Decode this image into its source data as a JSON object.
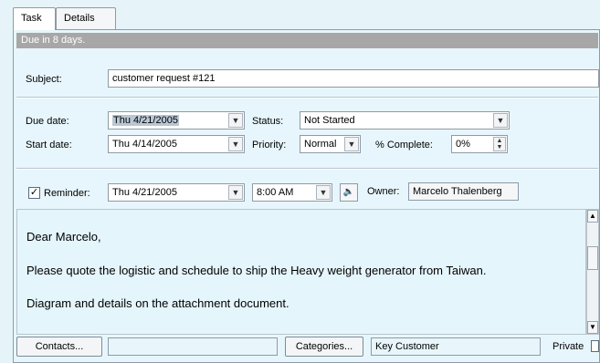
{
  "tabs": [
    {
      "label": "Task"
    },
    {
      "label": "Details"
    }
  ],
  "due_bar": {
    "text": "Due in 8 days."
  },
  "subject": {
    "label": "Subject:",
    "value": "customer request #121"
  },
  "due_date": {
    "label": "Due date:",
    "value": "Thu 4/21/2005"
  },
  "start_date": {
    "label": "Start date:",
    "value": "Thu 4/14/2005"
  },
  "status": {
    "label": "Status:",
    "value": "Not Started"
  },
  "priority": {
    "label": "Priority:",
    "value": "Normal"
  },
  "complete": {
    "label": "% Complete:",
    "value": "0%"
  },
  "reminder": {
    "label": "Reminder:",
    "checked": true,
    "date": "Thu 4/21/2005",
    "time": "8:00 AM"
  },
  "owner": {
    "label": "Owner:",
    "value": "Marcelo Thalenberg"
  },
  "body": {
    "greeting": "Dear Marcelo,",
    "line1": " Please quote the logistic and schedule to ship the Heavy weight generator from Taiwan.",
    "line2": "Diagram and details on the attachment document."
  },
  "footer": {
    "contacts_button": "Contacts...",
    "contacts_value": "",
    "categories_button": "Categories...",
    "categories_value": "Key Customer",
    "private_label": "Private"
  },
  "icons": {
    "dropdown": "chevron-down-icon",
    "speaker": "speaker-icon",
    "spin": "spin-icon",
    "check": "check-icon"
  }
}
